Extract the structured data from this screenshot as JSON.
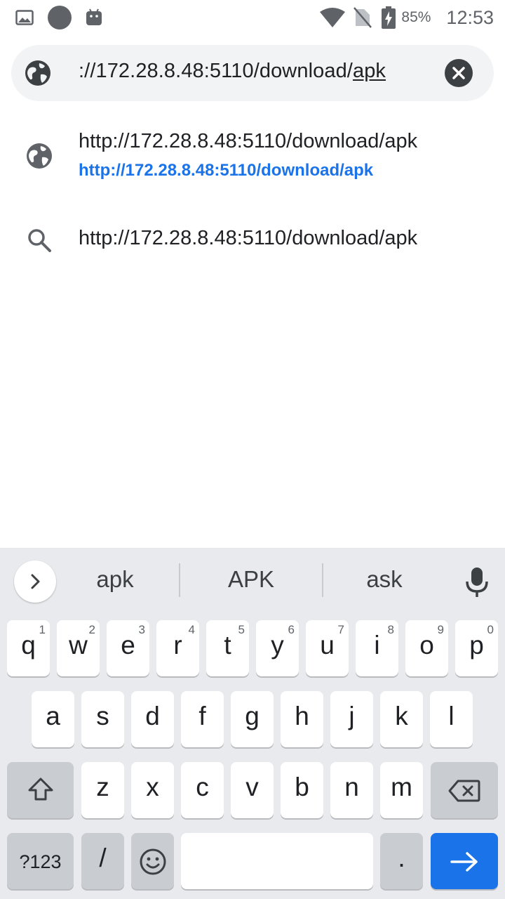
{
  "status_bar": {
    "battery_percent": "85%",
    "time": "12:53",
    "icons_left": [
      "image-icon",
      "circle-notification-icon",
      "android-icon"
    ],
    "icons_right": [
      "wifi-icon",
      "no-sim-icon",
      "battery-charging-icon"
    ]
  },
  "omnibox": {
    "url_prefix": "://172.28.8.48:5110/download/",
    "url_selected": "apk"
  },
  "suggestions": [
    {
      "icon": "globe-icon",
      "title": "http://172.28.8.48:5110/download/apk",
      "url": "http://172.28.8.48:5110/download/apk"
    },
    {
      "icon": "search-icon",
      "title": "http://172.28.8.48:5110/download/apk"
    }
  ],
  "keyboard": {
    "word_suggestions": [
      "apk",
      "APK",
      "ask"
    ],
    "row1": [
      {
        "key": "q",
        "hint": "1"
      },
      {
        "key": "w",
        "hint": "2"
      },
      {
        "key": "e",
        "hint": "3"
      },
      {
        "key": "r",
        "hint": "4"
      },
      {
        "key": "t",
        "hint": "5"
      },
      {
        "key": "y",
        "hint": "6"
      },
      {
        "key": "u",
        "hint": "7"
      },
      {
        "key": "i",
        "hint": "8"
      },
      {
        "key": "o",
        "hint": "9"
      },
      {
        "key": "p",
        "hint": "0"
      }
    ],
    "row2": [
      "a",
      "s",
      "d",
      "f",
      "g",
      "h",
      "j",
      "k",
      "l"
    ],
    "row3": [
      "z",
      "x",
      "c",
      "v",
      "b",
      "n",
      "m"
    ],
    "symbols_label": "?123",
    "slash_label": "/",
    "period_label": ".",
    "accent_color": "#1a73e8"
  }
}
